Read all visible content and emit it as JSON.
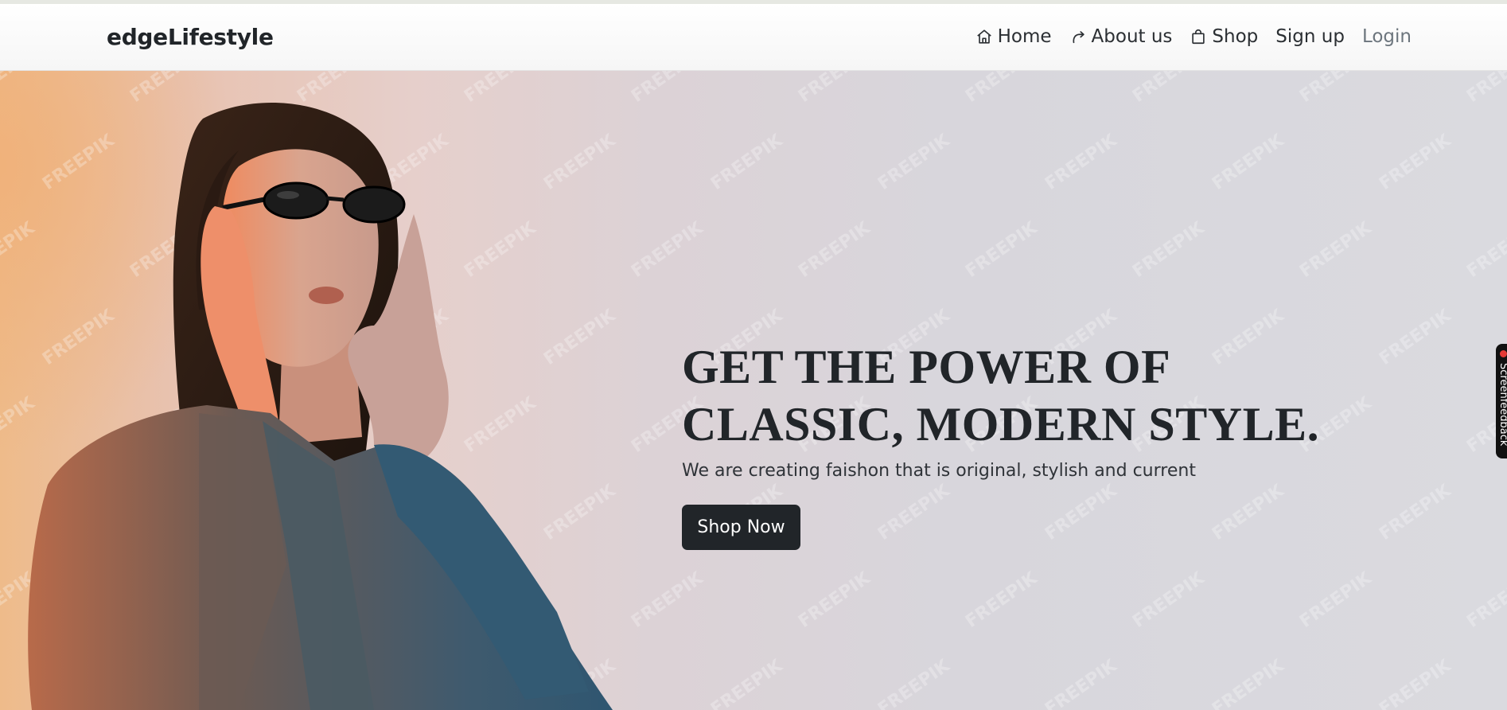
{
  "brand": {
    "name": "edgeLifestyle"
  },
  "nav": {
    "home": "Home",
    "about": "About us",
    "shop": "Shop",
    "signup": "Sign up",
    "login": "Login"
  },
  "hero": {
    "headline_line1": "GET THE POWER OF",
    "headline_line2": "CLASSIC, MODERN STYLE.",
    "subtext": "We are creating faishon that is original, stylish and current",
    "cta_label": "Shop Now",
    "watermark_text": "FREEPIK"
  },
  "side_widget": {
    "label": "Screenfeedback"
  },
  "colors": {
    "brand_dark": "#212529",
    "muted": "#6c757d",
    "warm": "#eebb8a",
    "cool": "#dadadf"
  },
  "icons": {
    "home": "house-icon",
    "about": "share-arrow-icon",
    "shop": "shopping-bag-icon"
  }
}
